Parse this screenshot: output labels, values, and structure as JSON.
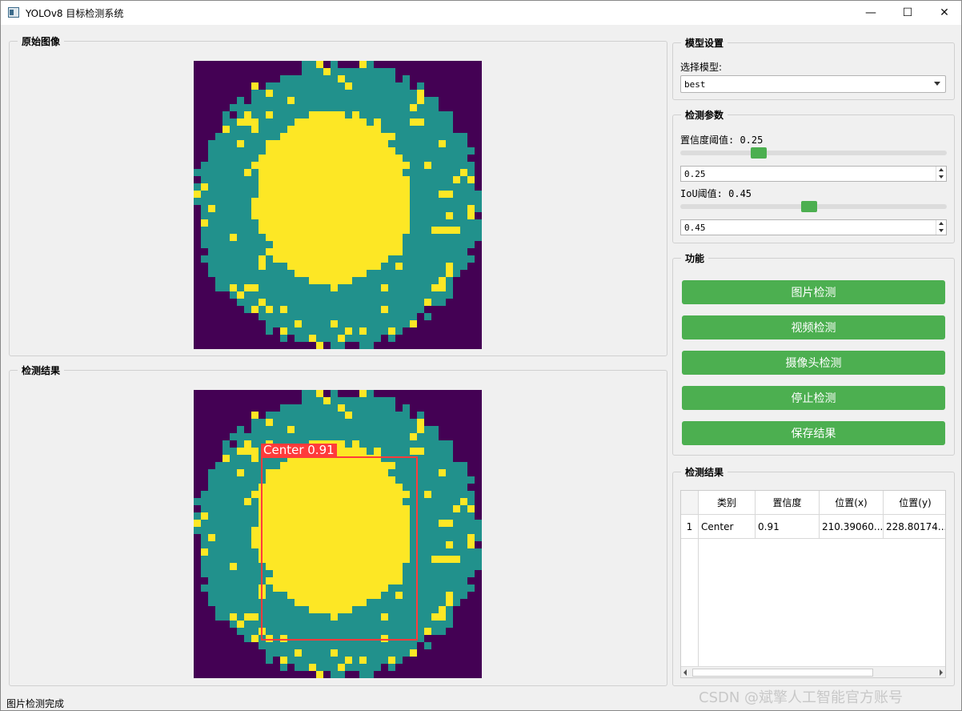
{
  "window": {
    "title": "YOLOv8 目标检测系统",
    "controls": {
      "minimize": "—",
      "maximize": "☐",
      "close": "✕"
    }
  },
  "original_image": {
    "group_title": "原始图像"
  },
  "result_image": {
    "group_title": "检测结果",
    "detection_label": "Center 0.91"
  },
  "model_settings": {
    "group_title": "模型设置",
    "select_label": "选择模型:",
    "selected_model": "best"
  },
  "detection_params": {
    "group_title": "检测参数",
    "confidence_label": "置信度阈值: 0.25",
    "confidence_value": "0.25",
    "confidence_level": 0.25,
    "iou_label": "IoU阈值: 0.45",
    "iou_value": "0.45",
    "iou_level": 0.45
  },
  "functions": {
    "group_title": "功能",
    "image_detect": "图片检测",
    "video_detect": "视频检测",
    "camera_detect": "摄像头检测",
    "stop_detect": "停止检测",
    "save_result": "保存结果"
  },
  "results_table": {
    "group_title": "检测结果",
    "columns": [
      "类别",
      "置信度",
      "位置(x)",
      "位置(y)"
    ],
    "rows": [
      {
        "index": "1",
        "class": "Center",
        "confidence": "0.91",
        "x": "210.39060...",
        "y": "228.80174..."
      }
    ]
  },
  "status": {
    "text": "图片检测完成"
  },
  "watermark": "CSDN @斌擎人工智能官方账号",
  "colors": {
    "accent": "#4caf50",
    "box": "#ff3b3b",
    "bg_purple": "#440154",
    "teal": "#21918c",
    "yellow": "#fde725"
  }
}
